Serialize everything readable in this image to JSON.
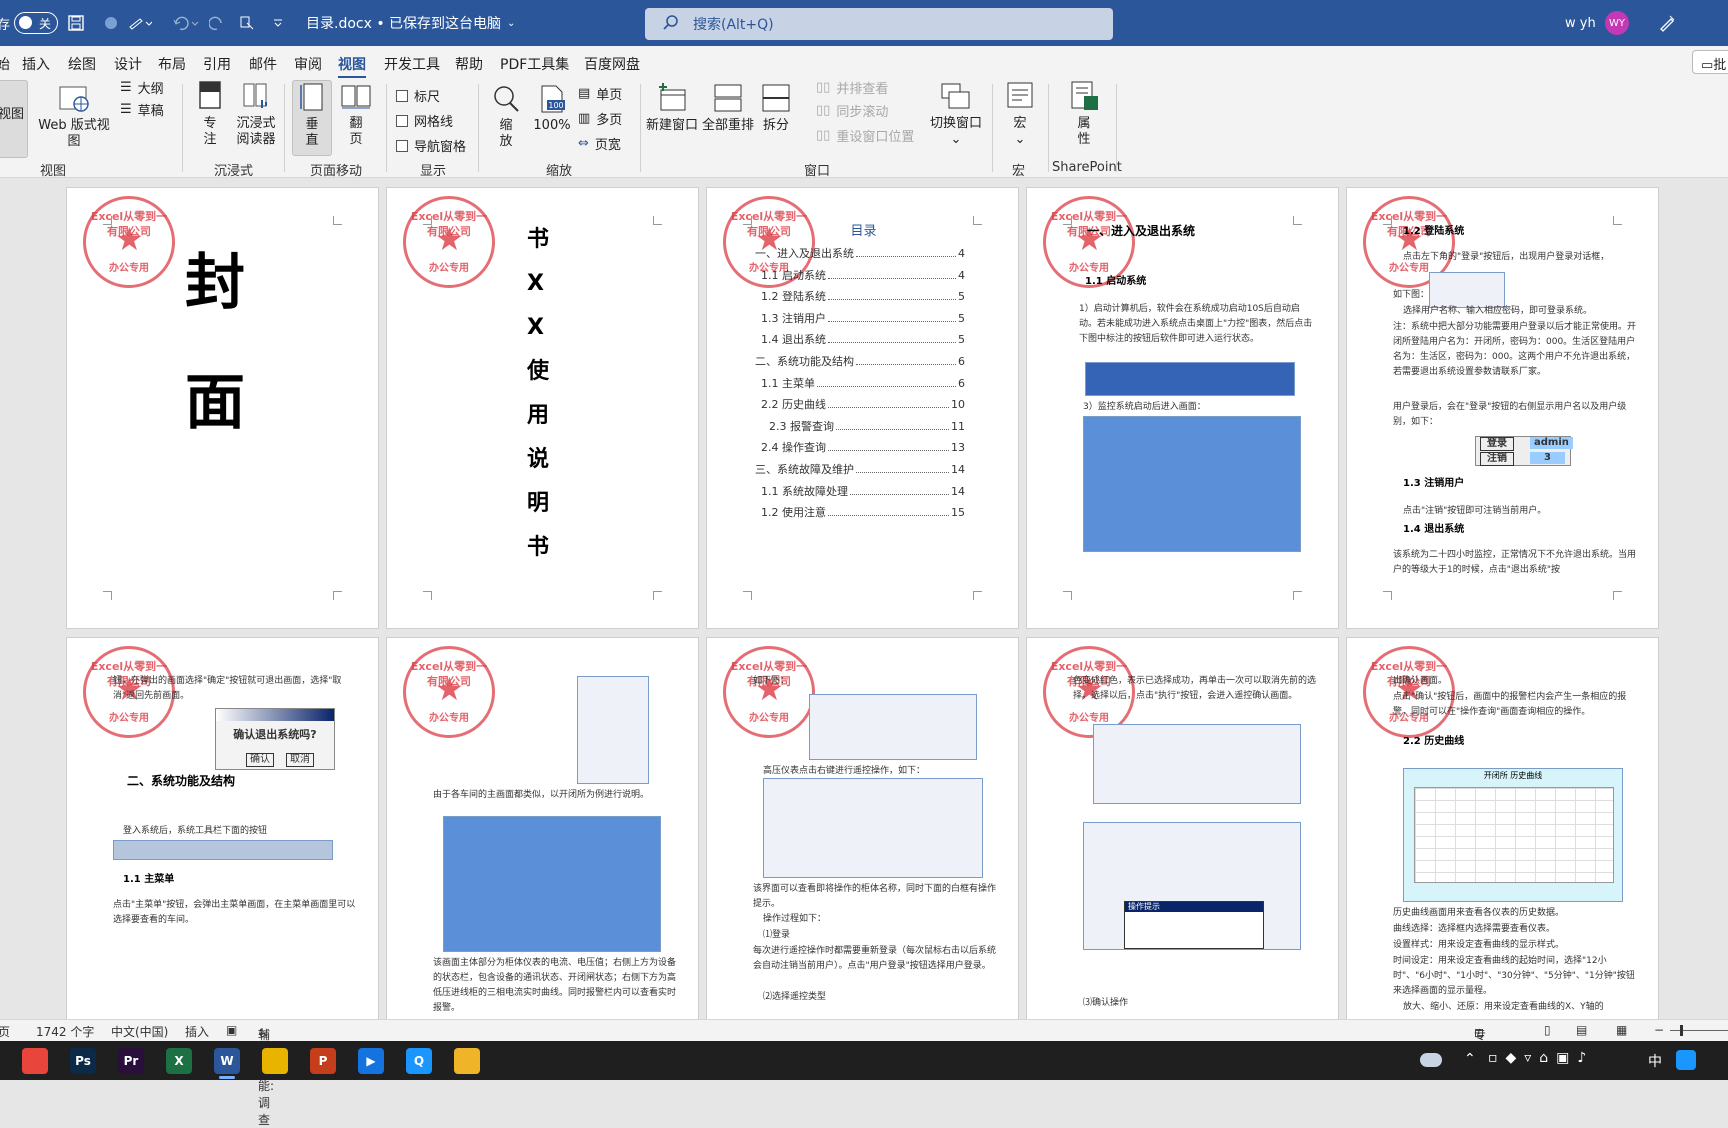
{
  "titlebar": {
    "autosave_label": "存",
    "toggle_label": "关",
    "doc_title": "目录.docx • 已保存到这台电脑",
    "search_placeholder": "搜索(Alt+Q)",
    "user_name": "w yh",
    "avatar_initials": "WY"
  },
  "menu": {
    "items": [
      "始",
      "插入",
      "绘图",
      "设计",
      "布局",
      "引用",
      "邮件",
      "审阅",
      "视图",
      "开发工具",
      "帮助",
      "PDF工具集",
      "百度网盘"
    ],
    "active": "视图",
    "right_label": "批"
  },
  "ribbon": {
    "view": {
      "read_view": "视图",
      "web_view": "Web 版式视图",
      "outline": "大纲",
      "draft": "草稿",
      "group": "视图"
    },
    "immersive": {
      "focus_l1": "专",
      "focus_l2": "注",
      "reader_l1": "沉浸式",
      "reader_l2": "阅读器",
      "group": "沉浸式"
    },
    "page_move": {
      "vertical_l1": "垂",
      "vertical_l2": "直",
      "flip_l1": "翻",
      "flip_l2": "页",
      "group": "页面移动"
    },
    "show": {
      "ruler": "标尺",
      "gridlines": "网格线",
      "nav_pane": "导航窗格",
      "group": "显示"
    },
    "zoom": {
      "zoom_l1": "缩",
      "zoom_l2": "放",
      "hundred": "100%",
      "hundred_icon": "100",
      "one_page": "单页",
      "multi_page": "多页",
      "page_width": "页宽",
      "group": "缩放"
    },
    "window": {
      "new_window": "新建窗口",
      "arrange_all": "全部重排",
      "split": "拆分",
      "side_by_side": "并排查看",
      "sync_scroll": "同步滚动",
      "reset_pos": "重设窗口位置",
      "switch_window": "切换窗口",
      "group": "窗口"
    },
    "macros": {
      "label": "宏",
      "group": "宏"
    },
    "sharepoint": {
      "prop_l1": "属",
      "prop_l2": "性",
      "group": "SharePoint"
    }
  },
  "pages": {
    "stamp_top": "Excel从零到一有限公司",
    "stamp_bottom": "办公专用",
    "cover": [
      "封",
      "面"
    ],
    "title_chars": [
      "书",
      "X",
      "X",
      "使",
      "用",
      "说",
      "明",
      "书"
    ],
    "toc": {
      "heading": "目录",
      "entries": [
        {
          "text": "一、进入及退出系统",
          "page": "4"
        },
        {
          "text": "1.1 启动系统",
          "page": "4"
        },
        {
          "text": "1.2 登陆系统",
          "page": "5"
        },
        {
          "text": "1.3 注销用户",
          "page": "5"
        },
        {
          "text": "1.4 退出系统",
          "page": "5"
        },
        {
          "text": "二、系统功能及结构",
          "page": "6"
        },
        {
          "text": "1.1 主菜单",
          "page": "6"
        },
        {
          "text": "2.2 历史曲线",
          "page": "10"
        },
        {
          "text": "2.3 报警查询",
          "page": "11"
        },
        {
          "text": "2.4 操作查询",
          "page": "13"
        },
        {
          "text": "三、系统故障及维护",
          "page": "14"
        },
        {
          "text": "1.1 系统故障处理",
          "page": "14"
        },
        {
          "text": "1.2 使用注意",
          "page": "15"
        }
      ]
    },
    "p4": {
      "h1": "一、进入及退出系统",
      "h2": "1.1 启动系统",
      "para": "1）启动计算机后，软件会在系统成功启动10S后自动启动。若未能成功进入系统点击桌面上\"力控\"图表，然后点击下图中标注的按钮后软件即可进入运行状态。",
      "step3": "3）监控系统启动后进入画面："
    },
    "p5": {
      "h2a": "1.2 登陆系统",
      "para1": "点击左下角的\"登录\"按钮后，出现用户登录对话框，",
      "para1b": "如下图：",
      "para2": "选择用户名称、输入相应密码，即可登录系统。",
      "para3": "注：系统中把大部分功能需要用户登录以后才能正常使用。开闭所登陆用户名为：开闭所，密码为：000。生活区登陆用户名为：生活区，密码为：000。这两个用户不允许退出系统，若需要退出系统设置参数请联系厂家。",
      "para4": "用户登录后，会在\"登录\"按钮的右侧显示用户名以及用户级别，如下：",
      "login_label": "登录",
      "logout_label": "注销",
      "user_value": "admin",
      "level_value": "3",
      "h2b": "1.3 注销用户",
      "para5": "点击\"注销\"按钮即可注销当前用户。",
      "h2c": "1.4 退出系统",
      "para6": "该系统为二十四小时监控，正常情况下不允许退出系统。当用户的等级大于1的时候，点击\"退出系统\"按"
    },
    "p6": {
      "para1": "钮，在弹出的画面选择\"确定\"按钮就可退出画面，选择\"取消\"返回先前画面。",
      "dialog_text": "确认退出系统吗?",
      "ok": "确认",
      "cancel": "取消",
      "h1": "二、系统功能及结构",
      "para2": "登入系统后，系统工具栏下面的按钮",
      "h2": "1.1 主菜单",
      "para3": "点击\"主菜单\"按钮，会弹出主菜单画面，在主菜单画面里可以选择要查看的车间。"
    },
    "p7": {
      "para1": "由于各车间的主画面都类似，以开闭所为例进行说明。",
      "para2": "该画面主体部分为柜体仪表的电流、电压值；右侧上方为设备的状态栏，包含设备的通讯状态、开闭闸状态；右侧下方为高低压进线柜的三相电流实时曲线。同时报警栏内可以查看实时报警。"
    },
    "p8": {
      "para1": "如下图：",
      "para2": "高压仪表点击右键进行遥控操作，如下：",
      "para3": "该界面可以查看即将操作的柜体名称，同时下面的白框有操作提示。",
      "para4": "操作过程如下：",
      "para5": "⑴登录",
      "para6": "每次进行遥控操作时都需要重新登录（每次鼠标右击以后系统会自动注销当前用户）。点击\"用户登录\"按钮选择用户登录。",
      "para7": "⑵选择遥控类型"
    },
    "p9": {
      "para1": "色变成红色，表示已选择成功，再单击一次可以取消先前的选择。选择以后，点击\"执行\"按钮，会进入遥控确认画面。",
      "para2": "⑶确认操作",
      "dialog_title": "操作提示"
    },
    "p10": {
      "para1": "出确认画面。",
      "para2": "点击\"确认\"按钮后，画面中的报警栏内会产生一条相应的报警，同时可以在\"操作查询\"画面查询相应的操作。",
      "h2": "2.2 历史曲线",
      "chart_title": "开闭所 历史曲线",
      "para3": "历史曲线画面用来查看各仪表的历史数据。",
      "para4": "曲线选择：选择框内选择需要查看仪表。",
      "para5": "设置样式：用来设定查看曲线的显示样式。",
      "para6": "时间设定：用来设定查看曲线的起始时间，选择\"12小时\"、\"6小时\"、\"1小时\"、\"30分钟\"、\"5分钟\"、\"1分钟\"按钮来选择画面的显示量程。",
      "para7": "放大、缩小、还原：用来设定查看曲线的X、Y轴的"
    }
  },
  "statusbar": {
    "page_label": "页",
    "word_count": "1742 个字",
    "language": "中文(中国)",
    "insert_mode": "插入",
    "accessibility": "辅助功能: 调查",
    "focus": "专注"
  },
  "taskbar": {
    "apps": [
      {
        "name": "chrome",
        "label": "",
        "color": "#e8453c"
      },
      {
        "name": "photoshop",
        "label": "Ps",
        "color": "#0a2a47"
      },
      {
        "name": "premiere",
        "label": "Pr",
        "color": "#2a0f3d"
      },
      {
        "name": "excel",
        "label": "X",
        "color": "#1d7044"
      },
      {
        "name": "word",
        "label": "W",
        "color": "#2b579a"
      },
      {
        "name": "files",
        "label": "",
        "color": "#e8b400"
      },
      {
        "name": "powerpoint",
        "label": "P",
        "color": "#c43e1c"
      },
      {
        "name": "video",
        "label": "▶",
        "color": "#1573e0"
      },
      {
        "name": "qq",
        "label": "Q",
        "color": "#1a96ff"
      },
      {
        "name": "explorer",
        "label": "",
        "color": "#f0b429"
      }
    ],
    "ime": "中"
  },
  "colors": {
    "accent": "#2b579a",
    "stamp": "#dc3c46"
  }
}
